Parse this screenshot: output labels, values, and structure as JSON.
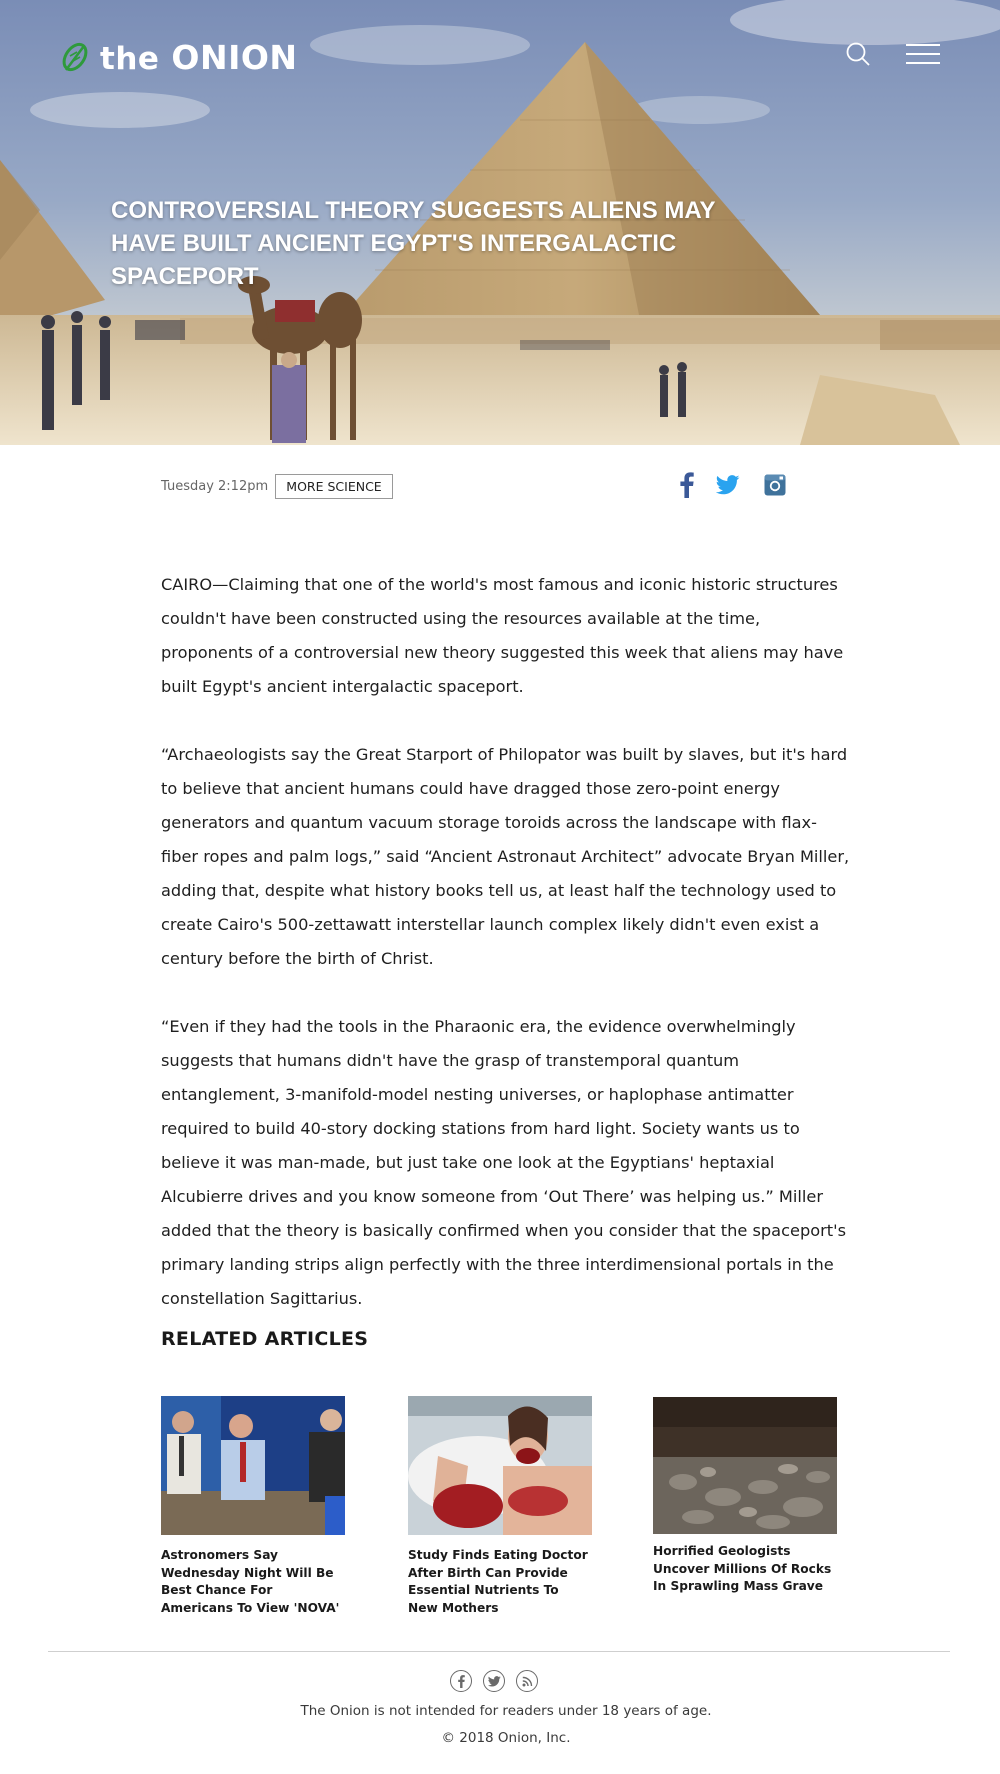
{
  "header": {
    "logo_word_the": "the",
    "logo_word_onion": "ONION"
  },
  "hero": {
    "headline": "CONTROVERSIAL THEORY SUGGESTS ALIENS MAY HAVE BUILT ANCIENT EGYPT'S INTERGALACTIC SPACEPORT"
  },
  "meta": {
    "date": "Tuesday 2:12pm",
    "category_label": "MORE SCIENCE"
  },
  "article": {
    "paragraphs": [
      "CAIRO—Claiming that one of the world's most famous and iconic historic structures couldn't have been constructed using the resources available at the time, proponents of a controversial new theory suggested this week that aliens may have built Egypt's ancient intergalactic spaceport.",
      "“Archaeologists say the Great Starport of Philopator was built by slaves, but it's hard to believe that ancient humans could have dragged those zero-point energy generators and quantum vacuum storage toroids across the landscape with flax-fiber ropes and palm logs,” said “Ancient Astronaut Architect” advocate Bryan Miller, adding that, despite what history books tell us, at least half the technology used to create Cairo's 500-zettawatt interstellar launch complex likely didn't even exist a century before the birth of Christ.",
      "“Even if they had the tools in the Pharaonic era, the evidence overwhelmingly suggests that humans didn't have the grasp of transtemporal quantum entanglement, 3-manifold-model nesting universes, or haplophase antimatter required to build 40-story docking stations from hard light. Society wants us to believe it was man-made, but just take one look at the Egyptians' heptaxial Alcubierre drives and you know someone from ‘Out There’ was helping us.” Miller added that the theory is basically confirmed when you consider that the spaceport's primary landing strips align perfectly with the three interdimensional portals in the constellation Sagittarius."
    ]
  },
  "related": {
    "heading": "RELATED ARTICLES",
    "items": [
      {
        "title": "Astronomers Say Wednesday Night Will Be Best Chance For Americans To View 'NOVA'"
      },
      {
        "title": "Study Finds Eating Doctor After Birth Can Provide Essential Nutrients To New Mothers"
      },
      {
        "title": "Horrified Geologists Uncover Millions Of Rocks In Sprawling Mass Grave"
      }
    ]
  },
  "footer": {
    "disclaimer": "The Onion is not intended for readers under 18 years of age.",
    "copyright": "© 2018 Onion, Inc."
  },
  "colors": {
    "logo_leaf": "#2e9a3c",
    "facebook": "#3b5998",
    "twitter": "#2aa3ef",
    "instagram": "#3f729b"
  },
  "icons": [
    "onion-leaf-icon",
    "search-icon",
    "menu-icon",
    "facebook-icon",
    "twitter-icon",
    "instagram-icon",
    "rss-icon"
  ]
}
